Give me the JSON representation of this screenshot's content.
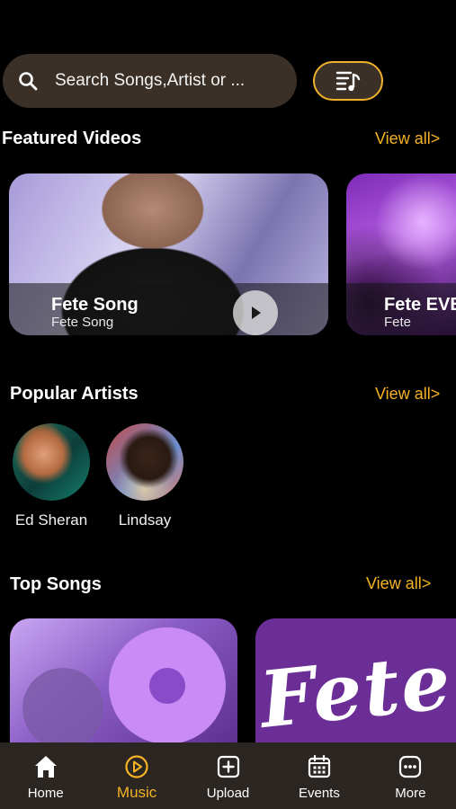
{
  "search": {
    "placeholder": "Search Songs,Artist or ..."
  },
  "featured": {
    "title": "Featured Videos",
    "view_all": "View all>",
    "videos": [
      {
        "title": "Fete Song",
        "subtitle": "Fete Song"
      },
      {
        "title": "Fete EVE",
        "subtitle": "Fete"
      }
    ]
  },
  "artists": {
    "title": "Popular Artists",
    "view_all": "View all>",
    "items": [
      {
        "name": "Ed Sheran"
      },
      {
        "name": "Lindsay"
      }
    ]
  },
  "top_songs": {
    "title": "Top Songs",
    "view_all": "View all>",
    "cards": [
      {
        "art_text": ""
      },
      {
        "art_text": "Fete"
      }
    ]
  },
  "tabbar": {
    "active": "Music",
    "accent": "#f5b323",
    "items": [
      {
        "label": "Home",
        "icon": "home-icon"
      },
      {
        "label": "Music",
        "icon": "play-circle-icon"
      },
      {
        "label": "Upload",
        "icon": "plus-square-icon"
      },
      {
        "label": "Events",
        "icon": "calendar-icon"
      },
      {
        "label": "More",
        "icon": "more-icon"
      }
    ]
  }
}
